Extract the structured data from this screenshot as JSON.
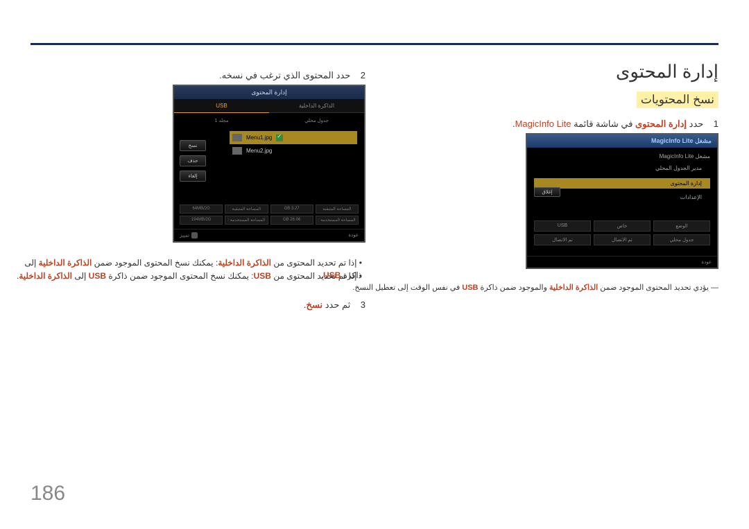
{
  "title": "إدارة المحتوى",
  "section": "نسخ المحتويات",
  "step1": {
    "num": "1",
    "text": "حدد ",
    "bold": "إدارة المحتوى",
    "text2": " في شاشة قائمة ",
    "product": "MagicInfo Lite",
    "text3": "."
  },
  "step2": {
    "num": "2",
    "text": "حدد المحتوى الذي ترغب في نسخه."
  },
  "step3": {
    "num": "3",
    "text": "ثم حدد ",
    "bold": "نسخ",
    "text2": "."
  },
  "bullet1": {
    "lead": "• إذا تم تحديد المحتوى من ",
    "em1": "الذاكرة الداخلية",
    "mid": ": يمكنك نسخ المحتوى الموجود ضمن ",
    "em2": "الذاكرة الداخلية",
    "mid2": " إلى ذاكرة ",
    "em3": "USB",
    "end": "."
  },
  "bullet2": {
    "lead": "• إذا تم تحديد المحتوى من ",
    "em1": "USB",
    "mid": ": يمكنك نسخ المحتوى الموجود ضمن ذاكرة ",
    "em2": "USB",
    "mid2": " إلى ",
    "em3": "الذاكرة الداخلية",
    "end": "."
  },
  "footnote": {
    "dash": "―",
    "text": " يؤدي تحديد المحتوى الموجود ضمن ",
    "em1": "الذاكرة الداخلية",
    "text2": " والموجود ضمن ذاكرة ",
    "em2": "USB",
    "text3": " في نفس الوقت إلى تعطيل النسخ."
  },
  "pageNum": "186",
  "shot1": {
    "title": "مشغل MagicInfo Lite",
    "h2": "مشغل MagicInfo Lite",
    "rows": {
      "r1": "مدير الجدول المحلي",
      "r2": "إدارة المحتوى",
      "r3": "الإعدادات"
    },
    "grid": {
      "a": "الوضع",
      "b": "خاص",
      "c": "USB",
      "d": "جدول محلي",
      "e": "تم الاتصال",
      "f": "تم الاتصال"
    },
    "close": "إغلاق",
    "footer": "عودة"
  },
  "shot2": {
    "title": "إدارة المحتوى",
    "tabs": {
      "a": "الذاكرة الداخلية",
      "b": "USB"
    },
    "sub": {
      "a": "جدول محلي",
      "b": "مجلد 1"
    },
    "items": {
      "a": "Menu1.jpg",
      "b": "Menu2.jpg"
    },
    "btns": {
      "a": "نسخ",
      "b": "حذف",
      "c": "إلغاء"
    },
    "stats": {
      "a": "المساحة المتبقية",
      "av": "3.27 GB",
      "b": "المساحة المتبقية",
      "bv": "64MB/2G",
      "c": "المساحة المستخدمة :",
      "cv": "26.06 GB",
      "d": "المساحة المستخدمة :",
      "dv": "194MB/2G"
    },
    "footer": {
      "back": "عودة",
      "mark": "تمييز"
    }
  }
}
